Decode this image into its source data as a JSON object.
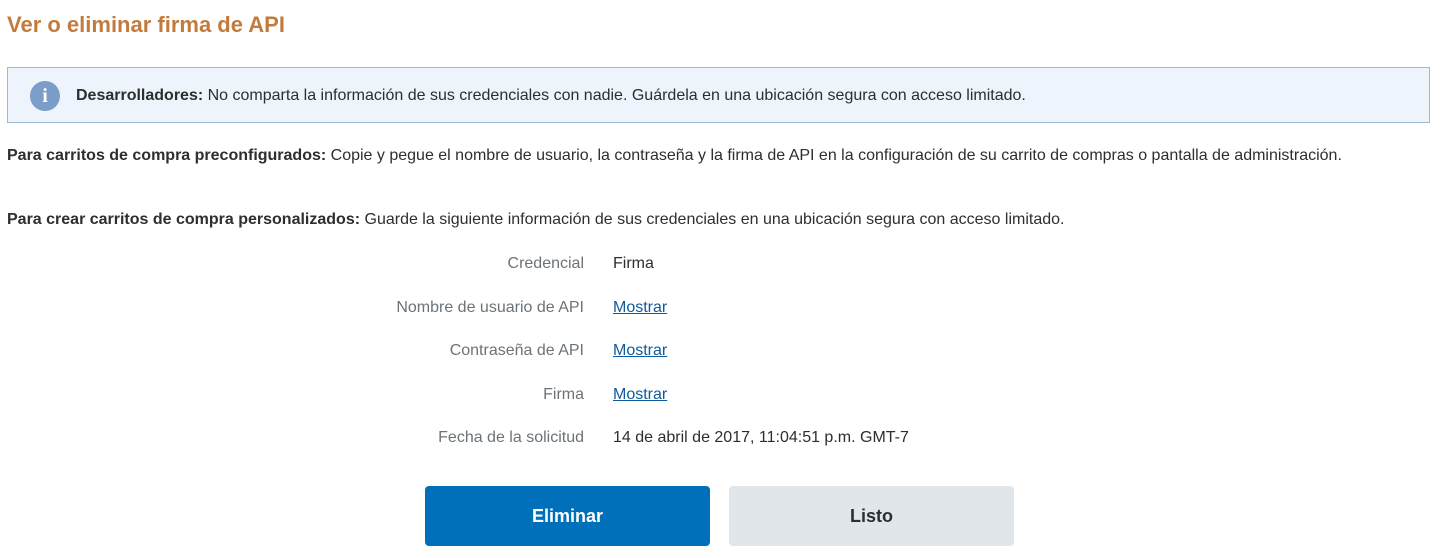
{
  "page": {
    "title": "Ver o eliminar firma de API"
  },
  "alert": {
    "icon": "info-icon",
    "icon_glyph": "i",
    "bold": "Desarrolladores:",
    "text": " No comparta la información de sus credenciales con nadie. Guárdela en una ubicación segura con acceso limitado."
  },
  "instructions": {
    "preconfigured": {
      "bold": "Para carritos de compra preconfigurados:",
      "text": " Copie y pegue el nombre de usuario, la contraseña y la firma de API en la configuración de su carrito de compras o pantalla de administración."
    },
    "custom": {
      "bold": "Para crear carritos de compra personalizados:",
      "text": " Guarde la siguiente información de sus credenciales en una ubicación segura con acceso limitado."
    }
  },
  "credentials": {
    "credential": {
      "label": "Credencial",
      "value": "Firma"
    },
    "username": {
      "label": "Nombre de usuario de API",
      "link": "Mostrar"
    },
    "password": {
      "label": "Contraseña de API",
      "link": "Mostrar"
    },
    "signature": {
      "label": "Firma",
      "link": "Mostrar"
    },
    "request_date": {
      "label": "Fecha de la solicitud",
      "value": "14 de abril de 2017, 11:04:51 p.m. GMT-7"
    }
  },
  "buttons": {
    "delete": "Eliminar",
    "done": "Listo"
  },
  "colors": {
    "title": "#c27b3c",
    "primary": "#0070ba",
    "secondary": "#e1e6ea",
    "link": "#0e5a9c",
    "alert_bg": "#eef4fb",
    "alert_border": "#9fbad0"
  }
}
